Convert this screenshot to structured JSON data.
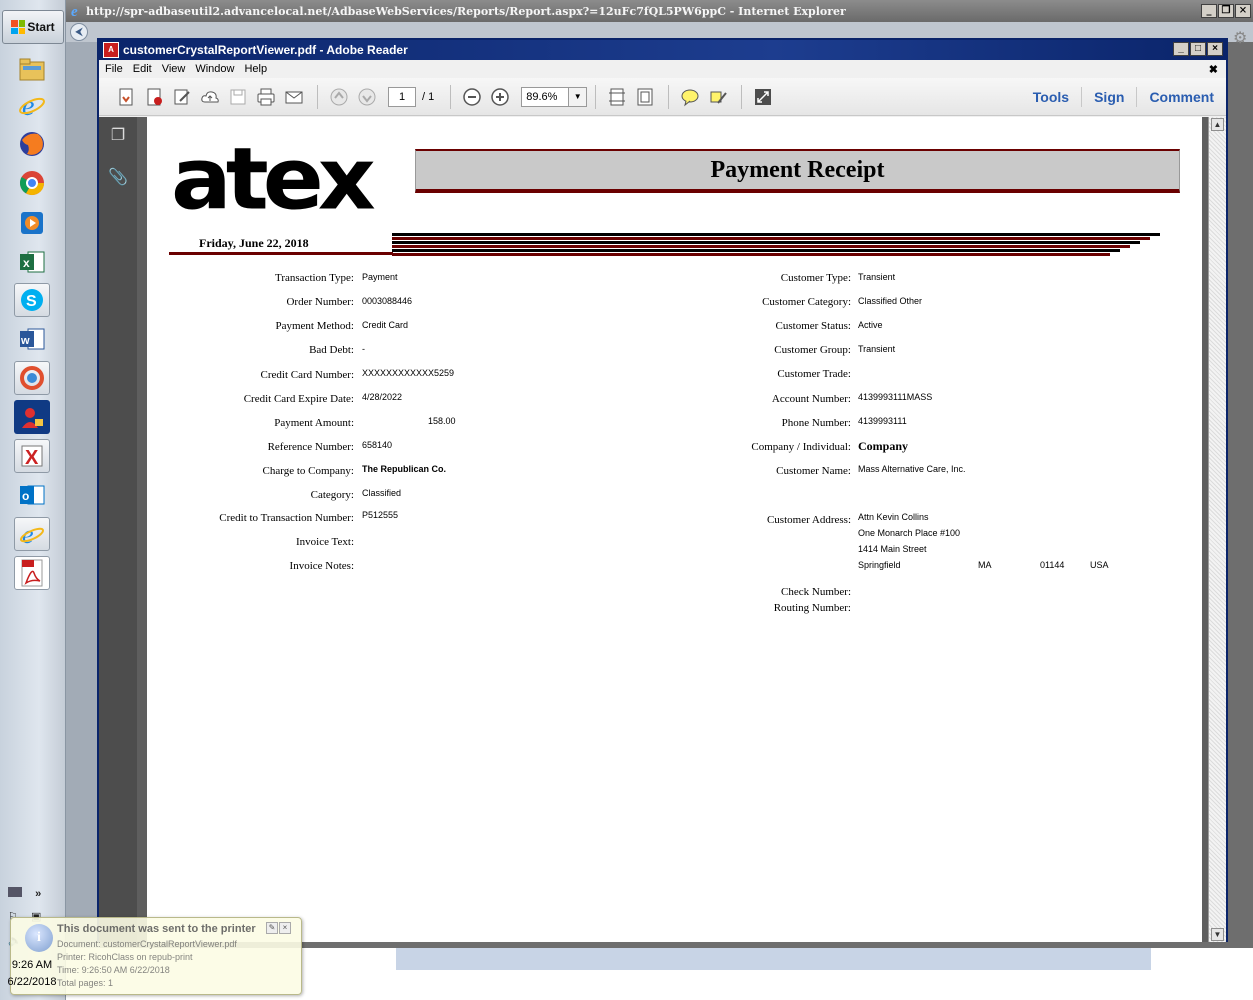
{
  "taskbar": {
    "start_label": "Start",
    "clock_time": "9:26 AM",
    "clock_date": "6/22/2018",
    "overflow_label": "»"
  },
  "ie": {
    "title": "http://spr-adbaseutil2.advancelocal.net/AdbaseWebServices/Reports/Report.aspx?=12uFc7fQL5PW6ppC - Internet Explorer"
  },
  "reader": {
    "title": "customerCrystalReportViewer.pdf - Adobe Reader",
    "menu": [
      "File",
      "Edit",
      "View",
      "Window",
      "Help"
    ],
    "page_current": "1",
    "page_total": "/ 1",
    "zoom": "89.6%",
    "right_links": [
      "Tools",
      "Sign",
      "Comment"
    ]
  },
  "report": {
    "logo": "atex",
    "title": "Payment Receipt",
    "date": "Friday, June 22, 2018",
    "left_fields": [
      {
        "label": "Transaction Type:",
        "value": "Payment"
      },
      {
        "label": "Order Number:",
        "value": "0003088446"
      },
      {
        "label": "Payment Method:",
        "value": "Credit Card"
      },
      {
        "label": "Bad Debt:",
        "value": "-"
      },
      {
        "label": "Credit Card Number:",
        "value": "XXXXXXXXXXXX5259"
      },
      {
        "label": "Credit Card Expire Date:",
        "value": "4/28/2022"
      },
      {
        "label": "Payment Amount:",
        "value": "158.00"
      },
      {
        "label": "Reference Number:",
        "value": "658140"
      },
      {
        "label": "Charge to Company:",
        "value": "The Republican Co."
      },
      {
        "label": "Category:",
        "value": "Classified"
      },
      {
        "label": "Credit to Transaction Number:",
        "value": "P512555"
      },
      {
        "label": "Invoice Text:",
        "value": ""
      },
      {
        "label": "Invoice Notes:",
        "value": ""
      }
    ],
    "right_fields": [
      {
        "label": "Customer Type:",
        "value": "Transient"
      },
      {
        "label": "Customer Category:",
        "value": "Classified Other"
      },
      {
        "label": "Customer Status:",
        "value": "Active"
      },
      {
        "label": "Customer Group:",
        "value": "Transient"
      },
      {
        "label": "Customer Trade:",
        "value": ""
      },
      {
        "label": "Account Number:",
        "value": "4139993111MASS"
      },
      {
        "label": "Phone Number:",
        "value": "4139993111"
      },
      {
        "label": "Company / Individual:",
        "value": "Company"
      },
      {
        "label": "Customer Name:",
        "value": "Mass Alternative Care, Inc."
      }
    ],
    "address": {
      "label": "Customer Address:",
      "line1": "Attn Kevin Collins",
      "line2": "One Monarch Place #100",
      "line3": "1414 Main Street",
      "city": "Springfield",
      "state": "MA",
      "zip": "01144",
      "country": "USA"
    },
    "check_number_label": "Check Number:",
    "routing_number_label": "Routing Number:"
  },
  "notification": {
    "title": "This document was sent to the printer",
    "document": "Document: customerCrystalReportViewer.pdf",
    "printer": "Printer: RicohClass on repub-print",
    "time": "Time: 9:26:50 AM 6/22/2018",
    "pages": "Total pages: 1"
  },
  "colors": {
    "reader_title": "#0a246a",
    "report_accent": "#6a0000",
    "link_blue": "#2a5db0"
  }
}
